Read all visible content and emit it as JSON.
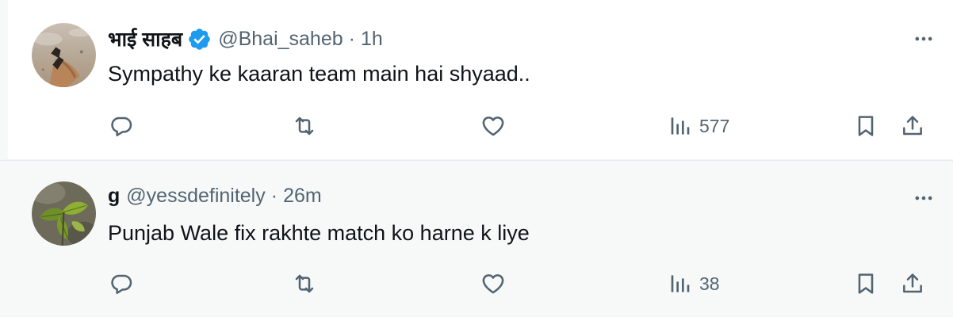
{
  "tweets": [
    {
      "name": "भाई साहब",
      "verified": true,
      "handle": "@Bhai_saheb",
      "separator": "·",
      "time": "1h",
      "text": "Sympathy ke kaaran team main hai shyaad..",
      "views": "577",
      "avatar": "avatar-beach-legs"
    },
    {
      "name": "g",
      "verified": false,
      "handle": "@yessdefinitely",
      "separator": "·",
      "time": "26m",
      "text": "Punjab Wale fix rakhte match ko harne k liye",
      "views": "38",
      "avatar": "avatar-green-leaves"
    }
  ],
  "icons": {
    "reply": "reply-icon",
    "retweet": "retweet-icon",
    "like": "heart-icon",
    "views": "views-icon",
    "bookmark": "bookmark-icon",
    "share": "share-icon",
    "more": "more-icon",
    "verified": "verified-badge-icon"
  },
  "colors": {
    "text_primary": "#0f1419",
    "text_secondary": "#536471",
    "verified_blue": "#1d9bf0",
    "hover_background": "#f7f9f9"
  }
}
